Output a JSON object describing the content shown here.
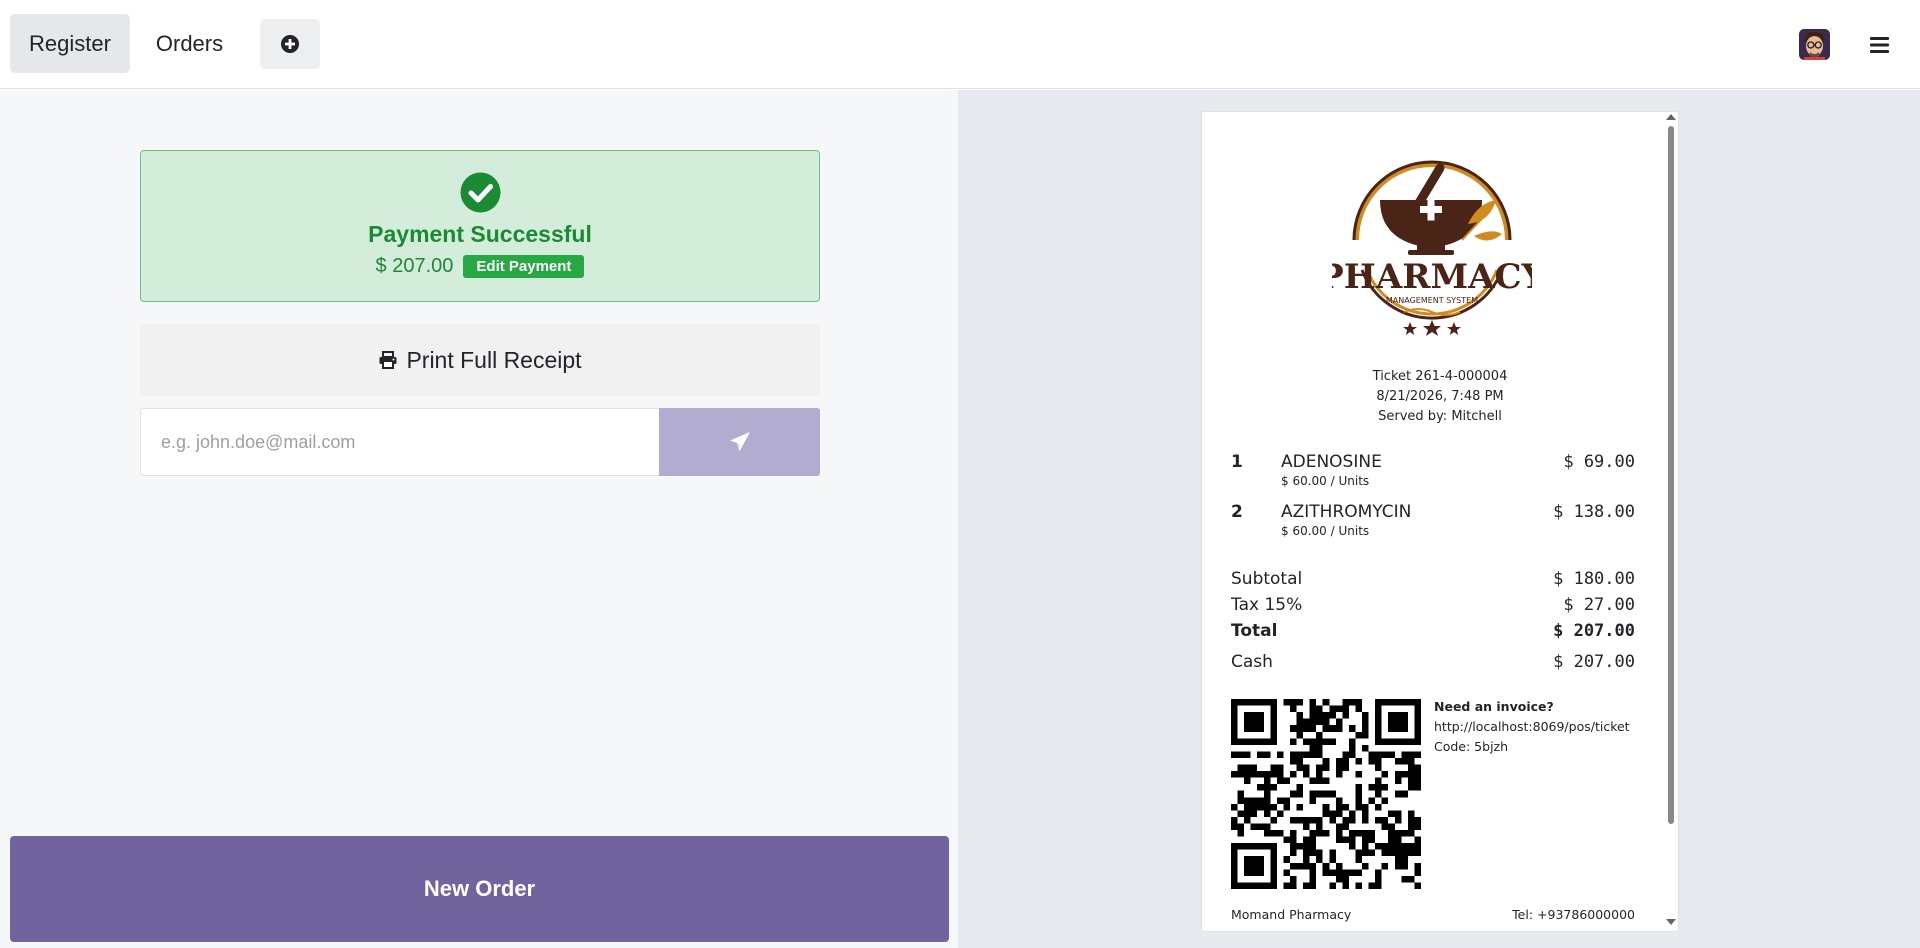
{
  "topbar": {
    "tabs": [
      {
        "label": "Register"
      },
      {
        "label": "Orders"
      }
    ],
    "add_tab_icon": "plus-circle-icon",
    "avatar_icon": "user-avatar",
    "menu_icon": "hamburger-icon"
  },
  "payment": {
    "status_title": "Payment Successful",
    "amount": "$ 207.00",
    "edit_label": "Edit Payment",
    "print_label": "Print Full Receipt",
    "email_placeholder": "e.g. john.doe@mail.com",
    "email_value": "",
    "send_icon": "paper-plane-icon",
    "new_order_label": "New Order"
  },
  "receipt": {
    "logo_text": "PHARMACY",
    "logo_subtext": "MANAGEMENT SYSTEM",
    "ticket": "Ticket 261-4-000004",
    "datetime": "8/21/2026, 7:48 PM",
    "served_by": "Served by: Mitchell",
    "lines": [
      {
        "qty": "1",
        "name": "ADENOSINE",
        "unit_price": "$ 60.00 / Units",
        "price": "$ 69.00"
      },
      {
        "qty": "2",
        "name": "AZITHROMYCIN",
        "unit_price": "$ 60.00 / Units",
        "price": "$ 138.00"
      }
    ],
    "subtotal_label": "Subtotal",
    "subtotal": "$ 180.00",
    "tax_label": "Tax 15%",
    "tax": "$ 27.00",
    "total_label": "Total",
    "total": "$ 207.00",
    "payment_method": "Cash",
    "payment_amount": "$ 207.00",
    "invoice_title": "Need an invoice?",
    "invoice_url": "http://localhost:8069/pos/ticket",
    "invoice_code": "Code: 5bjzh",
    "company": "Momand Pharmacy",
    "phone": "Tel: +93786000000"
  },
  "colors": {
    "success_bg": "#d4ecda",
    "success_text": "#1a8a34",
    "edit_button": "#28a745",
    "send_button": "#b3acd1",
    "primary": "#71639e",
    "logo_brown": "#4a2417",
    "logo_gold": "#d08a1e"
  }
}
